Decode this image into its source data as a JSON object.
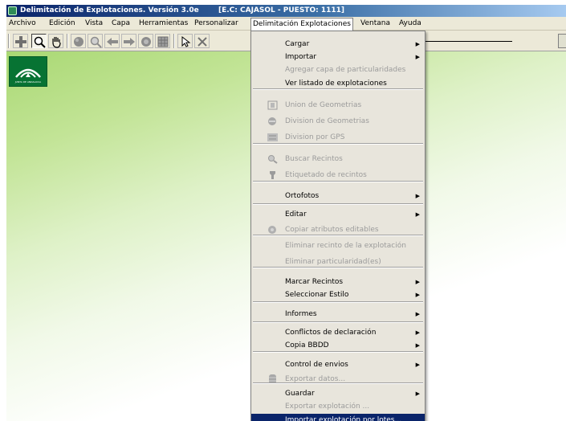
{
  "window": {
    "title": "Delimitación de Explotaciones. Versión 3.0e",
    "session": "[E.C: CAJASOL - PUESTO: 1111]"
  },
  "menubar": [
    {
      "label": "Archivo"
    },
    {
      "label": "Edición"
    },
    {
      "label": "Vista"
    },
    {
      "label": "Capa"
    },
    {
      "label": "Herramientas"
    },
    {
      "label": "Personalizar"
    },
    {
      "label": "Delimitación Explotaciones"
    },
    {
      "label": "Ventana"
    },
    {
      "label": "Ayuda"
    }
  ],
  "toolbar": {
    "buttons": [
      {
        "icon": "add-icon"
      },
      {
        "icon": "zoom-icon"
      },
      {
        "icon": "pan-hand-icon"
      },
      {
        "icon": "globe-icon"
      },
      {
        "icon": "zoom-out-icon"
      },
      {
        "icon": "back-arrow-icon"
      },
      {
        "icon": "forward-arrow-icon"
      },
      {
        "icon": "refresh-icon"
      },
      {
        "icon": "grid-icon"
      },
      {
        "icon": "pointer-icon"
      },
      {
        "icon": "cut-icon"
      }
    ]
  },
  "map": {
    "logo_caption": "JUNTA DE ANDALUCIA"
  },
  "dropdown": {
    "items": [
      {
        "label": "Cargar",
        "submenu": true,
        "disabled": false
      },
      {
        "label": "Importar",
        "submenu": true,
        "disabled": false
      },
      {
        "label": "Agregar capa de particularidades",
        "submenu": false,
        "disabled": true
      },
      {
        "label": "Ver listado de explotaciones",
        "submenu": false,
        "disabled": false
      },
      {
        "label": "Union de Geometrias",
        "submenu": false,
        "disabled": true,
        "icon": "union-icon"
      },
      {
        "label": "Division de Geometrias",
        "submenu": false,
        "disabled": true,
        "icon": "division-icon"
      },
      {
        "label": "Division por GPS",
        "submenu": false,
        "disabled": true,
        "icon": "gps-icon"
      },
      {
        "label": "Buscar Recintos",
        "submenu": false,
        "disabled": true,
        "icon": "search-icon"
      },
      {
        "label": "Etiquetado de recintos",
        "submenu": false,
        "disabled": true,
        "icon": "pin-icon"
      },
      {
        "label": "Ortofotos",
        "submenu": true,
        "disabled": false
      },
      {
        "label": "Editar",
        "submenu": true,
        "disabled": false
      },
      {
        "label": "Copiar atributos editables",
        "submenu": false,
        "disabled": true,
        "icon": "copy-icon"
      },
      {
        "label": "Eliminar recinto de la explotación",
        "submenu": false,
        "disabled": true
      },
      {
        "label": "Eliminar particularidad(es)",
        "submenu": false,
        "disabled": true
      },
      {
        "label": "Marcar Recintos",
        "submenu": true,
        "disabled": false
      },
      {
        "label": "Seleccionar Estilo",
        "submenu": true,
        "disabled": false
      },
      {
        "label": "Informes",
        "submenu": true,
        "disabled": false
      },
      {
        "label": "Conflictos de declaración",
        "submenu": true,
        "disabled": false
      },
      {
        "label": "Copia BBDD",
        "submenu": true,
        "disabled": false
      },
      {
        "label": "Control de envios",
        "submenu": true,
        "disabled": false
      },
      {
        "label": "Exportar datos...",
        "submenu": false,
        "disabled": true,
        "icon": "database-icon"
      },
      {
        "label": "Guardar",
        "submenu": true,
        "disabled": false
      },
      {
        "label": "Exportar explotación ...",
        "submenu": false,
        "disabled": true
      },
      {
        "label": "Importar explotación por lotes...",
        "submenu": false,
        "disabled": false,
        "highlighted": true
      }
    ]
  },
  "colors": {
    "titlebar": "#0a246a",
    "menu_background": "#e8e5dc",
    "highlight": "#0a246a",
    "disabled_text": "#9b9b9b",
    "logo_green": "#077333"
  }
}
